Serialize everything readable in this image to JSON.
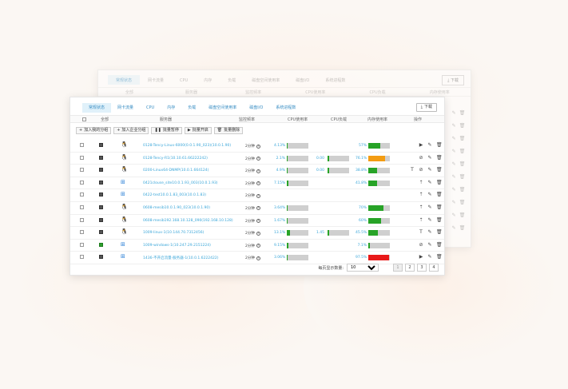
{
  "back_panel": {
    "tabs": [
      "常规状态",
      "网卡流量",
      "CPU",
      "内存",
      "负载",
      "磁盘空间使用率",
      "磁盘I/O",
      "系统进程数"
    ],
    "download_label": "下载",
    "headers": [
      "全部",
      "服务器",
      "监控频率",
      "CPU使用率",
      "CPU负载",
      "内存使用率"
    ]
  },
  "tabs": [
    {
      "label": "常规状态",
      "active": true
    },
    {
      "label": "网卡流量",
      "active": false
    },
    {
      "label": "CPU",
      "active": false
    },
    {
      "label": "内存",
      "active": false
    },
    {
      "label": "负载",
      "active": false
    },
    {
      "label": "磁盘空间使用率",
      "active": false
    },
    {
      "label": "磁盘I/O",
      "active": false
    },
    {
      "label": "系统进程数",
      "active": false
    }
  ],
  "download_label": "下载",
  "headers": {
    "all": "全部",
    "server": "服务器",
    "frequency": "监控频率",
    "cpu_usage": "CPU使用率",
    "cpu_load": "CPU负载",
    "mem_usage": "内存使用率",
    "actions": "操作"
  },
  "toolbar": {
    "add_group": "加入我的分组",
    "add_enterprise": "加入企业分组",
    "batch_pause": "批量暂停",
    "batch_start": "批量开启",
    "batch_delete": "批量删除"
  },
  "rows": [
    {
      "os": "linux",
      "status": "dark",
      "server": "0128-Tency-Linux-6000(0.0.1.90_023)(10.0.1.90)",
      "freq": "2分钟",
      "cpu": "4.13%",
      "cpu_frac": 0.04,
      "load": "",
      "mem": "57%",
      "mem_frac": 0.57,
      "mem_color": "green",
      "ops": [
        "play",
        "edit",
        "trash"
      ]
    },
    {
      "os": "linux",
      "status": "dark",
      "server": "0128-Tency-R1(10.10.61.66222242)",
      "freq": "2分钟",
      "cpu": "2.1%",
      "cpu_frac": 0.02,
      "load": "0.00",
      "mem": "76.1%",
      "mem_frac": 0.76,
      "mem_color": "orange",
      "ops": [
        "ban",
        "edit",
        "trash"
      ]
    },
    {
      "os": "linux",
      "status": "dark",
      "server": "0200-Linux64-DNMP(10.0.1.664124)",
      "freq": "2分钟",
      "cpu": "4.9%",
      "cpu_frac": 0.05,
      "load": "0.00",
      "mem": "38.8%",
      "mem_frac": 0.39,
      "mem_color": "green",
      "ops": [
        "text",
        "ban",
        "edit",
        "trash"
      ]
    },
    {
      "os": "win",
      "status": "dark",
      "server": "0421clouse_site10.0.1.93_003(10.0.1.93)",
      "freq": "2分钟",
      "cpu": "7.15%",
      "cpu_frac": 0.07,
      "load": "",
      "mem": "41.8%",
      "mem_frac": 0.42,
      "mem_color": "green",
      "ops": [
        "upload",
        "edit",
        "trash"
      ]
    },
    {
      "os": "win",
      "status": "dark",
      "server": "0422-test10.0.1.83_003(10.0.1.83)",
      "freq": "2分钟",
      "cpu": "",
      "cpu_frac": 0,
      "load": "",
      "mem": "",
      "mem_frac": 0,
      "mem_color": "green",
      "ops": [
        "upload",
        "edit",
        "trash"
      ]
    },
    {
      "os": "linux",
      "status": "dark",
      "server": "0608-mesib10.0.1.90_023(10.0.1.90)",
      "freq": "2分钟",
      "cpu": "3.64%",
      "cpu_frac": 0.04,
      "load": "",
      "mem": "70%",
      "mem_frac": 0.7,
      "mem_color": "green",
      "ops": [
        "upload",
        "edit",
        "trash"
      ]
    },
    {
      "os": "linux",
      "status": "dark",
      "server": "0608-mesib192.168.10.128_090(192.168.10.128)",
      "freq": "2分钟",
      "cpu": "1.67%",
      "cpu_frac": 0.02,
      "load": "",
      "mem": "60%",
      "mem_frac": 0.6,
      "mem_color": "green",
      "ops": [
        "upload",
        "edit",
        "trash"
      ]
    },
    {
      "os": "linux",
      "status": "dark",
      "server": "1009-linux-1(10.144.70.7312456)",
      "freq": "2分钟",
      "cpu": "13.1%",
      "cpu_frac": 0.13,
      "load": "1.45",
      "mem": "45.5%",
      "mem_frac": 0.46,
      "mem_color": "green",
      "ops": [
        "text",
        "edit",
        "trash"
      ]
    },
    {
      "os": "win",
      "status": "green",
      "server": "1009-windows-1(10.247.29.2151224)",
      "freq": "2分钟",
      "cpu": "9.15%",
      "cpu_frac": 0.09,
      "load": "",
      "mem": "7.1%",
      "mem_frac": 0.07,
      "mem_color": "green",
      "ops": [
        "ban",
        "edit",
        "trash"
      ]
    },
    {
      "os": "win",
      "status": "dark",
      "server": "1436-不开启流量-服务器-1(10.0.1.6222422)",
      "freq": "2分钟",
      "cpu": "3.06%",
      "cpu_frac": 0.03,
      "load": "",
      "mem": "97.5%",
      "mem_frac": 0.98,
      "mem_color": "red",
      "ops": [
        "play",
        "edit",
        "trash"
      ]
    }
  ],
  "pager": {
    "label": "每页显示数量:",
    "page_size": "10",
    "pages": [
      "1",
      "2",
      "3",
      "4"
    ],
    "active_page": "1"
  }
}
